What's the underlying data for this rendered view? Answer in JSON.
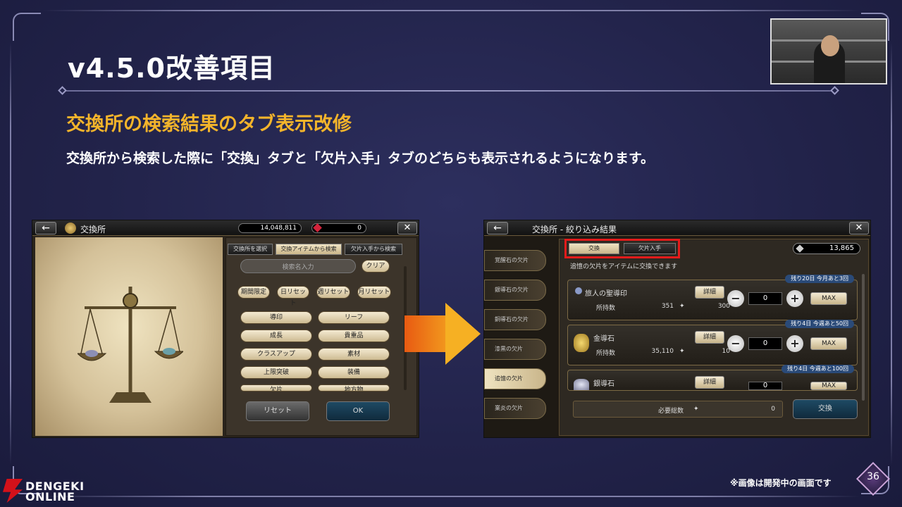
{
  "slide": {
    "title": "v4.5.0改善項目",
    "subtitle": "交換所の検索結果のタブ表示改修",
    "description": "交換所から検索した際に「交換」タブと「欠片入手」タブのどちらも表示されるようになります。",
    "footer_note": "※画像は開発中の画面です",
    "page_number": "36"
  },
  "logo": {
    "line1": "DENGEKI",
    "line2": "ONLINE"
  },
  "left_screen": {
    "header_title": "交換所",
    "currency_amount": "14,048,811",
    "gem_amount": "0",
    "tabs": [
      "交換所を選択",
      "交換アイテムから検索",
      "欠片入手から検索"
    ],
    "search_placeholder": "検索名入力",
    "clear_button": "クリア",
    "filter_row": [
      "期間限定",
      "日リセット",
      "週リセット",
      "月リセット"
    ],
    "categories": [
      "導印",
      "リーフ",
      "成長",
      "貴重品",
      "クラスアップ",
      "素材",
      "上限突破",
      "装備",
      "欠片",
      "地方物"
    ],
    "reset_button": "リセット",
    "ok_button": "OK"
  },
  "right_screen": {
    "header_title": "交換所 - 絞り込み結果",
    "tabs": [
      "交換",
      "欠片入手"
    ],
    "currency_amount": "13,865",
    "info_text": "追憶の欠片をアイテムに交換できます",
    "sidebar": [
      "覚醒石の欠片",
      "銀導石の欠片",
      "銅導石の欠片",
      "漆黒の欠片",
      "追憶の欠片",
      "業炎の欠片"
    ],
    "items": [
      {
        "name": "旅人の聖導印",
        "badge": "残り20日 今月あと3回",
        "owned_label": "所持数",
        "owned": "351",
        "cost": "300",
        "qty": "0"
      },
      {
        "name": "金導石",
        "badge": "残り4日 今週あと50回",
        "owned_label": "所持数",
        "owned": "35,110",
        "cost": "10",
        "qty": "0"
      },
      {
        "name": "銀導石",
        "badge": "残り4日 今週あと100回",
        "owned_label": "",
        "owned": "",
        "cost": "",
        "qty": "0"
      }
    ],
    "detail_label": "詳細",
    "minus": "−",
    "plus": "+",
    "max_label": "MAX",
    "total_label": "必要総数",
    "total_value": "0",
    "exchange_button": "交換"
  }
}
